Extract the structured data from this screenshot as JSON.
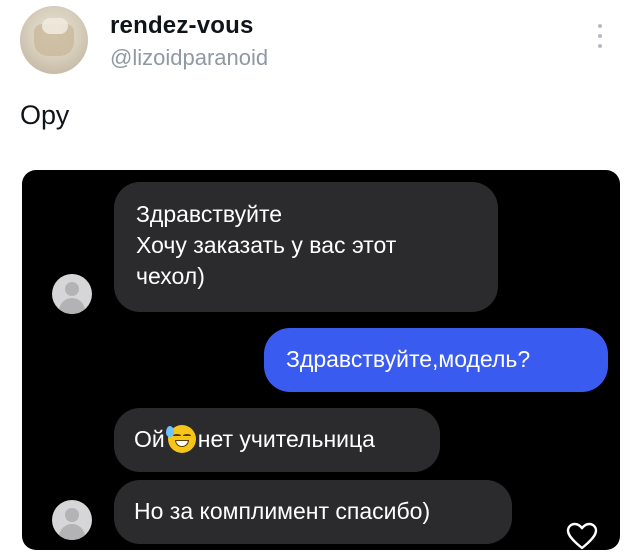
{
  "user": {
    "display_name": "rendez-vous",
    "handle": "@lizoidparanoid"
  },
  "tweet": {
    "text": "Ору"
  },
  "media": {
    "messages": [
      {
        "direction": "incoming",
        "lines": [
          "Здравствуйте",
          "Хочу заказать у вас этот",
          "чехол)"
        ]
      },
      {
        "direction": "outgoing",
        "text": "Здравствуйте,модель?"
      },
      {
        "direction": "incoming",
        "text_before_emoji": "Ой",
        "emoji": "sweat-smile-emoji",
        "text_after_emoji": "нет учительница"
      },
      {
        "direction": "incoming",
        "text": "Но за комплимент спасибо)"
      }
    ]
  },
  "icons": {
    "more": "more-vertical-icon",
    "heart": "heart-outline-icon"
  },
  "colors": {
    "outgoing_bubble": "#3a5bf0",
    "incoming_bubble": "#2b2b2d",
    "handle_text": "#8f98a3"
  }
}
